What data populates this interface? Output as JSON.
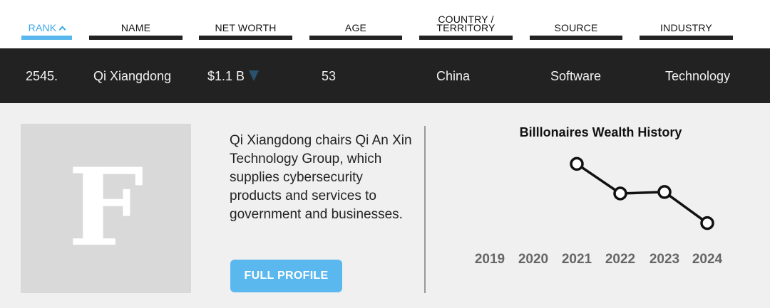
{
  "header": {
    "columns": [
      {
        "key": "rank",
        "label": "RANK",
        "active": true
      },
      {
        "key": "name",
        "label": "NAME"
      },
      {
        "key": "net_worth",
        "label": "NET WORTH"
      },
      {
        "key": "age",
        "label": "AGE"
      },
      {
        "key": "country",
        "label": "COUNTRY / TERRITORY"
      },
      {
        "key": "source",
        "label": "SOURCE"
      },
      {
        "key": "industry",
        "label": "INDUSTRY"
      }
    ]
  },
  "row": {
    "rank": "2545.",
    "name": "Qi Xiangdong",
    "net_worth": "$1.1 B",
    "age": "53",
    "country": "China",
    "source": "Software",
    "industry": "Technology"
  },
  "detail": {
    "avatar_letter": "F",
    "bio": "Qi Xiangdong chairs Qi An Xin Technology Group, which supplies cybersecurity products and services to government and businesses.",
    "button_label": "FULL PROFILE"
  },
  "colors": {
    "accent": "#5bb8ef",
    "dark_row": "#222222",
    "down_triangle": "#29526e"
  },
  "chart_data": {
    "type": "line",
    "title": "Billlonaires Wealth History",
    "x": [
      "2019",
      "2020",
      "2021",
      "2022",
      "2023",
      "2024"
    ],
    "series": [
      {
        "values": [
          null,
          null,
          1.9,
          1.5,
          1.52,
          1.1
        ]
      }
    ],
    "ylim": [
      1.0,
      2.0
    ],
    "grid": false
  }
}
